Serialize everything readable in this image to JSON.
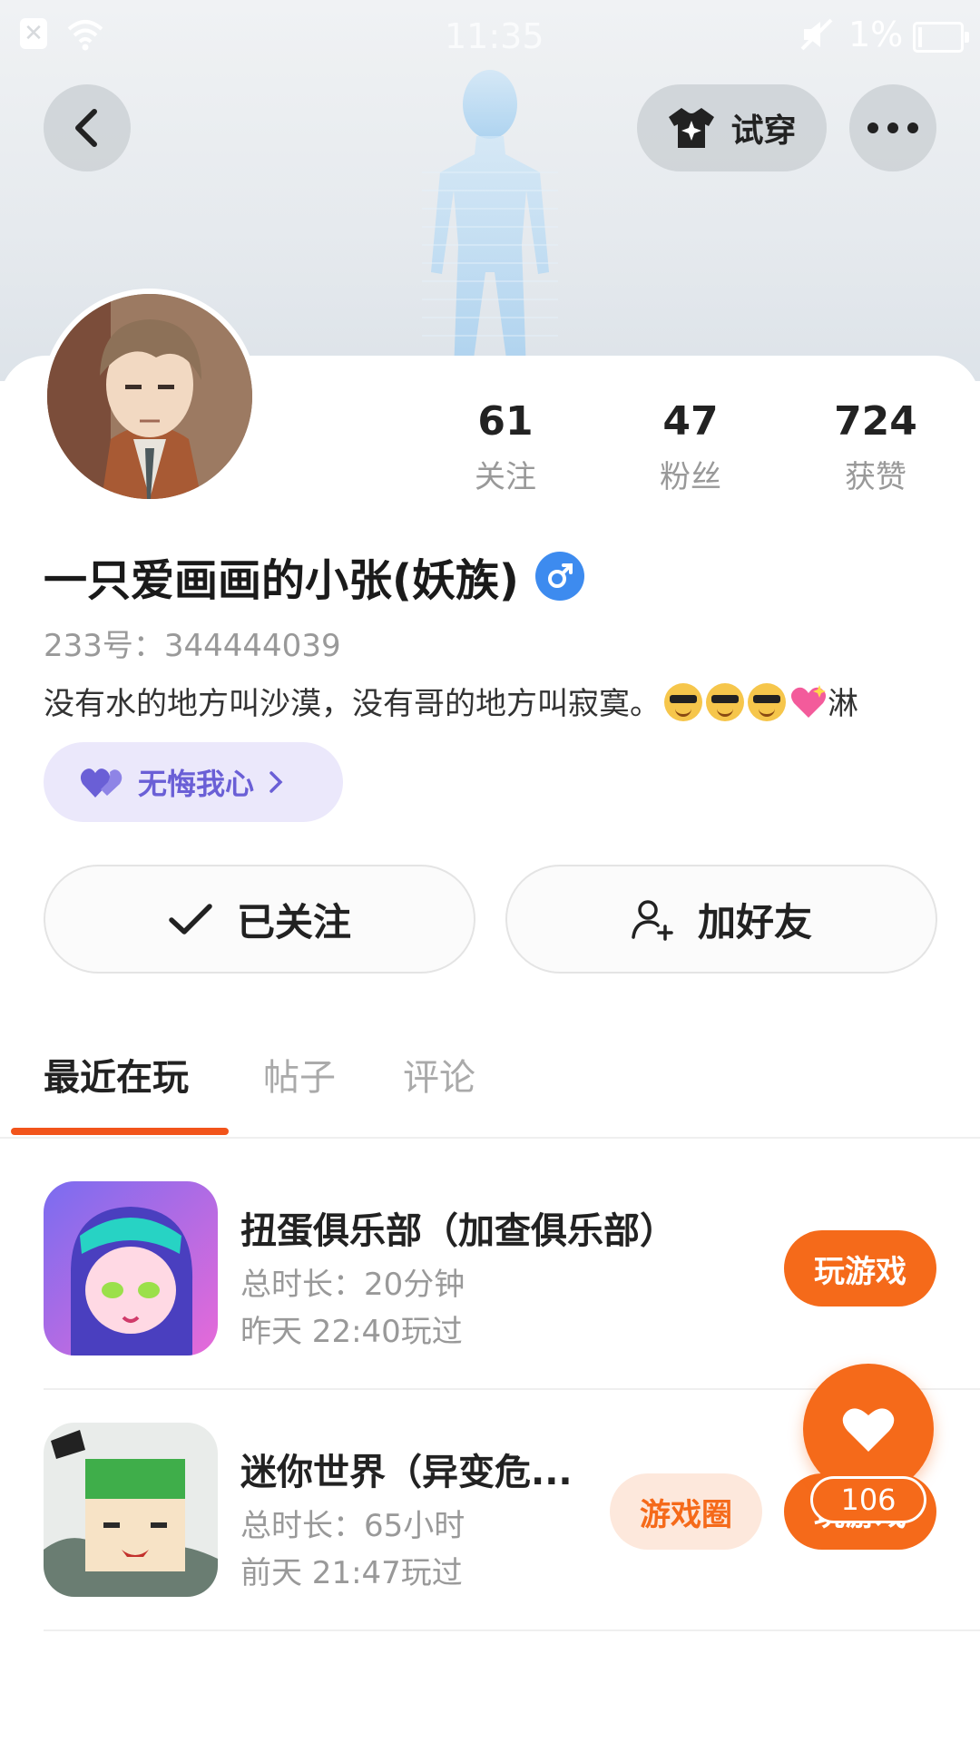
{
  "status_bar": {
    "time": "11:35",
    "battery": "1%"
  },
  "header": {
    "try_on_label": "试穿"
  },
  "stats": [
    {
      "value": "61",
      "label": "关注"
    },
    {
      "value": "47",
      "label": "粉丝"
    },
    {
      "value": "724",
      "label": "获赞"
    }
  ],
  "profile": {
    "name": "一只爱画画的小张(妖族)",
    "gender": "♂",
    "uid": "233号：344444039",
    "bio": "没有水的地方叫沙漠，没有哥的地方叫寂寞。",
    "bio_suffix": "淋",
    "tag": "无悔我心"
  },
  "actions": {
    "follow": "已关注",
    "add_friend": "加好友"
  },
  "tabs": [
    "最近在玩",
    "帖子",
    "评论"
  ],
  "games": [
    {
      "title": "扭蛋俱乐部（加查俱乐部）",
      "duration": "总时长：20分钟",
      "last_played": "昨天 22:40玩过",
      "play_label": "玩游戏"
    },
    {
      "title": "迷你世界（异变危...",
      "duration": "总时长：65小时",
      "last_played": "前天 21:47玩过",
      "circle_label": "游戏圈",
      "play_label": "玩游戏"
    }
  ],
  "like": {
    "count": "106"
  },
  "colors": {
    "accent": "#f56a1a",
    "tab_indicator": "#f2541b",
    "gender": "#3d8bef",
    "tag_text": "#6a5fd6"
  }
}
